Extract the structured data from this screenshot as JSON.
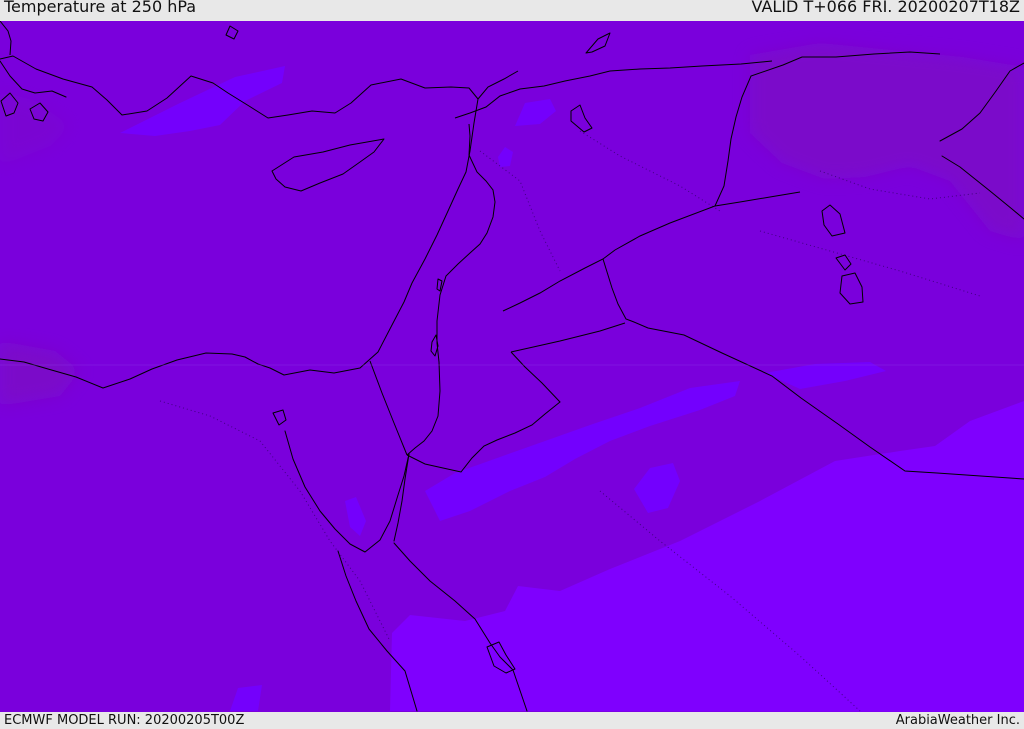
{
  "header": {
    "title": "Temperature at 250 hPa",
    "valid": "VALID T+066 FRI. 20200207T18Z"
  },
  "footer": {
    "model_run": "ECMWF MODEL RUN: 20200205T00Z",
    "credit": "ArabiaWeather Inc."
  },
  "colors": {
    "base_violet": "#7a00dc",
    "warm_violet": "#7c10c8",
    "cool_violet": "#7f00ff",
    "cool_blue": "#7300ff",
    "coast_line": "#000000",
    "border_line": "#000000"
  }
}
